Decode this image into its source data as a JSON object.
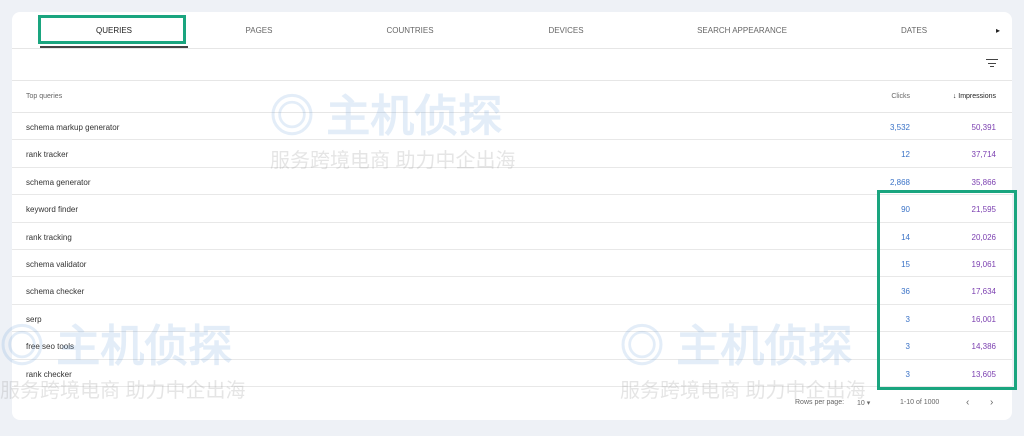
{
  "tabs": [
    "QUERIES",
    "PAGES",
    "COUNTRIES",
    "DEVICES",
    "SEARCH APPEARANCE",
    "DATES"
  ],
  "table": {
    "header_query": "Top queries",
    "header_clicks": "Clicks",
    "header_impressions": "Impressions",
    "rows": [
      {
        "query": "schema markup generator",
        "clicks": "3,532",
        "impressions": "50,391"
      },
      {
        "query": "rank tracker",
        "clicks": "12",
        "impressions": "37,714"
      },
      {
        "query": "schema generator",
        "clicks": "2,868",
        "impressions": "35,866"
      },
      {
        "query": "keyword finder",
        "clicks": "90",
        "impressions": "21,595"
      },
      {
        "query": "rank tracking",
        "clicks": "14",
        "impressions": "20,026"
      },
      {
        "query": "schema validator",
        "clicks": "15",
        "impressions": "19,061"
      },
      {
        "query": "schema checker",
        "clicks": "36",
        "impressions": "17,634"
      },
      {
        "query": "serp",
        "clicks": "3",
        "impressions": "16,001"
      },
      {
        "query": "free seo tools",
        "clicks": "3",
        "impressions": "14,386"
      },
      {
        "query": "rank checker",
        "clicks": "3",
        "impressions": "13,605"
      }
    ]
  },
  "pagination": {
    "rows_per_page_label": "Rows per page:",
    "rows_per_page": "10",
    "range": "1-10 of 1000",
    "prev": "‹",
    "next": "›"
  },
  "watermark": {
    "title": "主机侦探",
    "subtitle": "服务跨境电商 助力中企出海"
  },
  "colors": {
    "clicks": "#3b73c7",
    "impressions": "#7b3fb0",
    "highlight": "#1aa57f"
  }
}
